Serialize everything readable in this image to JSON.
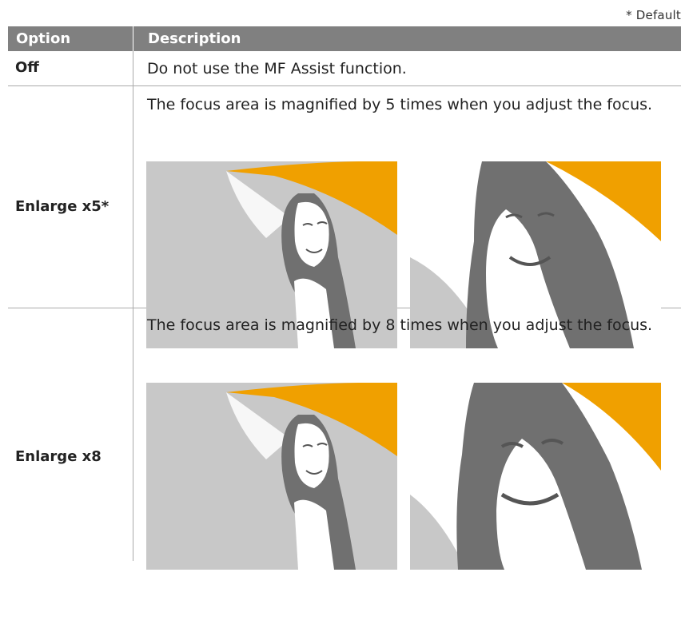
{
  "default_note": "* Default",
  "table": {
    "header": {
      "option": "Option",
      "description": "Description"
    },
    "rows": [
      {
        "option": "Off",
        "description": "Do not use the MF Assist function."
      },
      {
        "option": "Enlarge x5*",
        "description": "The focus area is magnified by 5 times when you adjust the focus."
      },
      {
        "option": "Enlarge x8",
        "description": "The focus area is magnified by 8 times when you adjust the focus."
      }
    ]
  },
  "colors": {
    "header_bg": "#808080",
    "umbrella": "#F0A000",
    "figure_dark": "#707070",
    "background_light": "#C8C8C8"
  }
}
